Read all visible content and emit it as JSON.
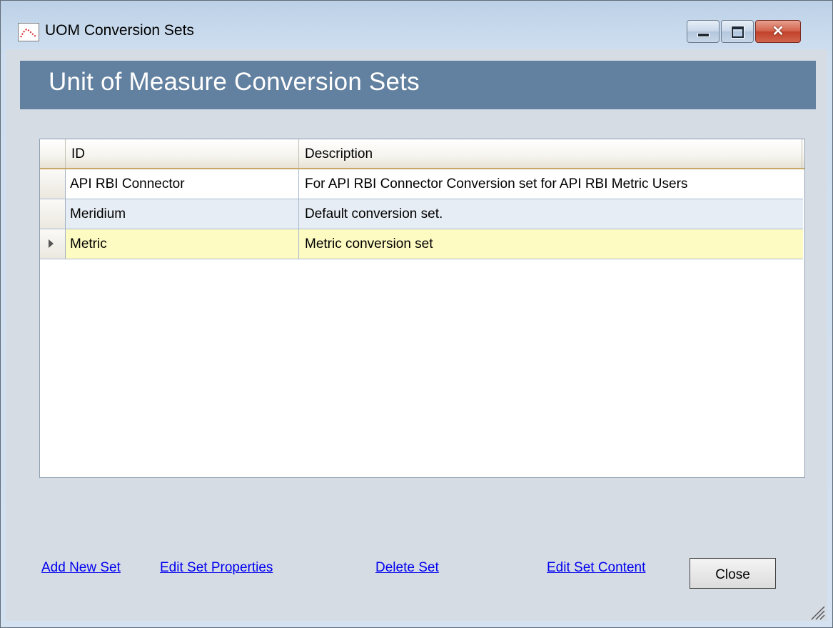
{
  "window": {
    "title": "UOM Conversion Sets"
  },
  "header": {
    "title": "Unit of Measure Conversion Sets"
  },
  "grid": {
    "columns": [
      "ID",
      "Description"
    ],
    "rows": [
      {
        "id": "API RBI Connector",
        "description": "For API RBI Connector Conversion set for API RBI Metric Users"
      },
      {
        "id": "Meridium",
        "description": "Default conversion set."
      },
      {
        "id": "Metric",
        "description": "Metric conversion set",
        "selected": true
      }
    ]
  },
  "actions": {
    "add_new_set": "Add New Set",
    "edit_set_properties": "Edit Set Properties",
    "delete_set": "Delete Set",
    "edit_set_content": "Edit Set Content",
    "close": "Close"
  },
  "colors": {
    "banner": "#62809f",
    "selected_row": "#fdfbc2",
    "alt_row": "#e7edf4",
    "link": "#0000ee"
  }
}
